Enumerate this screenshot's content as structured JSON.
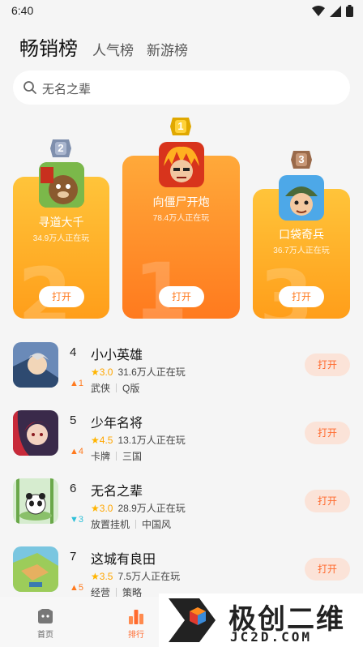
{
  "status": {
    "time": "6:40"
  },
  "tabs": [
    "畅销榜",
    "人气榜",
    "新游榜"
  ],
  "search": {
    "placeholder": "无名之辈"
  },
  "podium": [
    {
      "rank": "2",
      "name": "寻道大千",
      "players": "34.9万人正在玩",
      "button": "打开"
    },
    {
      "rank": "1",
      "name": "向僵尸开炮",
      "players": "78.4万人正在玩",
      "button": "打开"
    },
    {
      "rank": "3",
      "name": "口袋奇兵",
      "players": "36.7万人正在玩",
      "button": "打开"
    }
  ],
  "list": [
    {
      "rank": "4",
      "trend": "1",
      "trend_dir": "up",
      "name": "小小英雄",
      "score": "3.0",
      "players": "31.6万人正在玩",
      "tags": [
        "武侠",
        "Q版"
      ],
      "button": "打开"
    },
    {
      "rank": "5",
      "trend": "4",
      "trend_dir": "up",
      "name": "少年名将",
      "score": "4.5",
      "players": "13.1万人正在玩",
      "tags": [
        "卡牌",
        "三国"
      ],
      "button": "打开"
    },
    {
      "rank": "6",
      "trend": "3",
      "trend_dir": "down",
      "name": "无名之辈",
      "score": "3.0",
      "players": "28.9万人正在玩",
      "tags": [
        "放置挂机",
        "中国风"
      ],
      "button": "打开"
    },
    {
      "rank": "7",
      "trend": "5",
      "trend_dir": "up",
      "name": "这城有良田",
      "score": "3.5",
      "players": "7.5万人正在玩",
      "tags": [
        "经营",
        "策略"
      ],
      "button": "打开"
    }
  ],
  "nav": [
    {
      "label": "首页",
      "icon": "home-icon"
    },
    {
      "label": "排行",
      "icon": "ranking-icon"
    }
  ],
  "watermark": {
    "text": "极创二维",
    "url": "JC2D.COM"
  },
  "colors": {
    "accent": "#ff6a2e",
    "podium": "#ffa21e",
    "star": "#ffb400",
    "trend_up": "#ff7a1e",
    "trend_down": "#2fc0d8"
  }
}
